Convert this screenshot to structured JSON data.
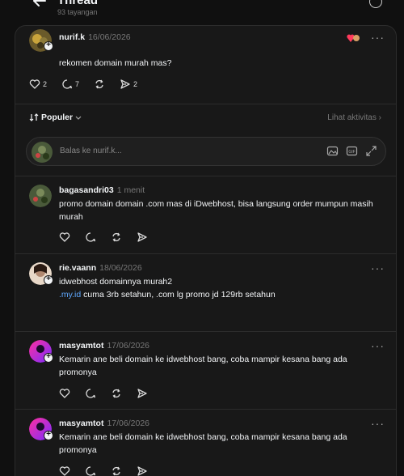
{
  "header": {
    "title": "Thread",
    "views": "93 tayangan"
  },
  "main_post": {
    "username": "nurif.k",
    "date": "16/06/2026",
    "text": "rekomen domain murah mas?",
    "likes": "2",
    "comments": "7",
    "shares": "2"
  },
  "sort": {
    "label": "Populer",
    "activity": "Lihat aktivitas"
  },
  "reply": {
    "placeholder": "Balas ke nurif.k..."
  },
  "replies": [
    {
      "username": "bagasandri03",
      "date": "1 menit",
      "text": "promo domain domain .com mas di iDwebhost, bisa langsung order mumpun masih murah"
    },
    {
      "username": "rie.vaann",
      "date": "18/06/2026",
      "line1": "idwebhost domainnya murah2",
      "link": ".my.id",
      "line2_rest": " cuma 3rb setahun, .com lg promo jd 129rb setahun"
    },
    {
      "username": "masyamtot",
      "date": "17/06/2026",
      "text": "Kemarin ane beli domain ke idwebhost bang, coba mampir kesana bang ada promonya"
    },
    {
      "username": "masyamtot",
      "date": "17/06/2026",
      "text": "Kemarin ane beli domain ke idwebhost bang, coba mampir kesana bang ada promonya"
    }
  ]
}
